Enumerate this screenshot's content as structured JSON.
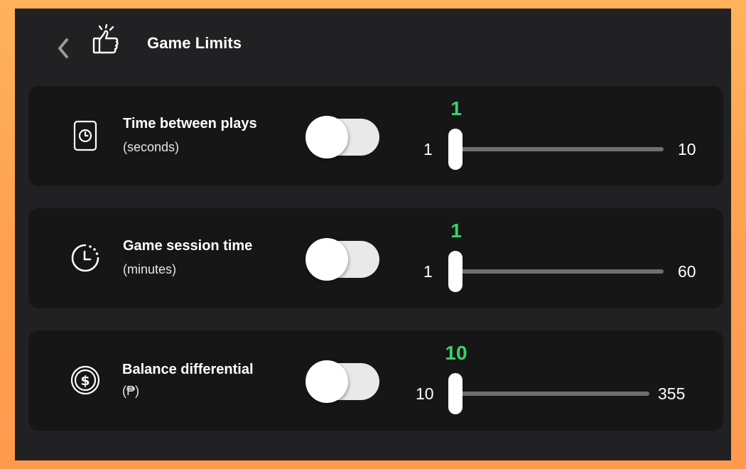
{
  "header": {
    "title": "Game Limits",
    "back_icon": "chevron-left-icon",
    "icon": "thumbs-up-icon"
  },
  "colors": {
    "accent_green": "#39d26a",
    "panel": "#212123",
    "card": "#161617"
  },
  "limits": [
    {
      "label": "Time between plays",
      "unit": "(seconds)",
      "icon": "clock-card-icon",
      "toggle_on": false,
      "value": "1",
      "min": "1",
      "max": "10"
    },
    {
      "label": "Game session time",
      "unit": "(minutes)",
      "icon": "timer-icon",
      "toggle_on": false,
      "value": "1",
      "min": "1",
      "max": "60"
    },
    {
      "label": "Balance differential",
      "unit": "(₱)",
      "icon": "coin-dollar-icon",
      "toggle_on": false,
      "value": "10",
      "min": "10",
      "max": "355"
    }
  ]
}
